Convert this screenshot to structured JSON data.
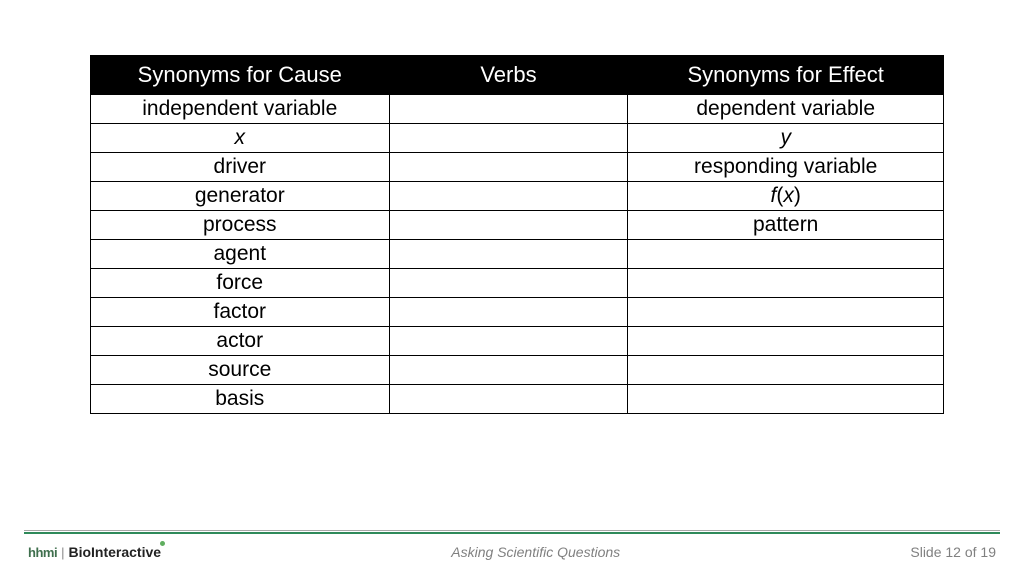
{
  "table": {
    "headers": {
      "cause": "Synonyms for Cause",
      "verbs": "Verbs",
      "effect": "Synonyms for Effect"
    },
    "rows": [
      {
        "cause": "independent variable",
        "verbs": "",
        "effect": "dependent variable",
        "cause_italic": false,
        "effect_italic": false
      },
      {
        "cause": "x",
        "verbs": "",
        "effect": "y",
        "cause_italic": true,
        "effect_italic": true
      },
      {
        "cause": "driver",
        "verbs": "",
        "effect": "responding variable",
        "cause_italic": false,
        "effect_italic": false
      },
      {
        "cause": "generator",
        "verbs": "",
        "effect_html": "<span class=\"ital\">f</span>(<span class=\"ital\">x</span>)",
        "effect": "f(x)",
        "cause_italic": false
      },
      {
        "cause": "process",
        "verbs": "",
        "effect": "pattern",
        "cause_italic": false,
        "effect_italic": false
      },
      {
        "cause": "agent",
        "verbs": "",
        "effect": "",
        "cause_italic": false,
        "effect_italic": false
      },
      {
        "cause": "force",
        "verbs": "",
        "effect": "",
        "cause_italic": false,
        "effect_italic": false
      },
      {
        "cause": "factor",
        "verbs": "",
        "effect": "",
        "cause_italic": false,
        "effect_italic": false
      },
      {
        "cause": "actor",
        "verbs": "",
        "effect": "",
        "cause_italic": false,
        "effect_italic": false
      },
      {
        "cause": "source",
        "verbs": "",
        "effect": "",
        "cause_italic": false,
        "effect_italic": false
      },
      {
        "cause": "basis",
        "verbs": "",
        "effect": "",
        "cause_italic": false,
        "effect_italic": false
      }
    ]
  },
  "footer": {
    "logo_hhmi": "hhmi",
    "logo_bio": "BioInteractive",
    "title": "Asking Scientific Questions",
    "page": "Slide 12 of 19"
  }
}
